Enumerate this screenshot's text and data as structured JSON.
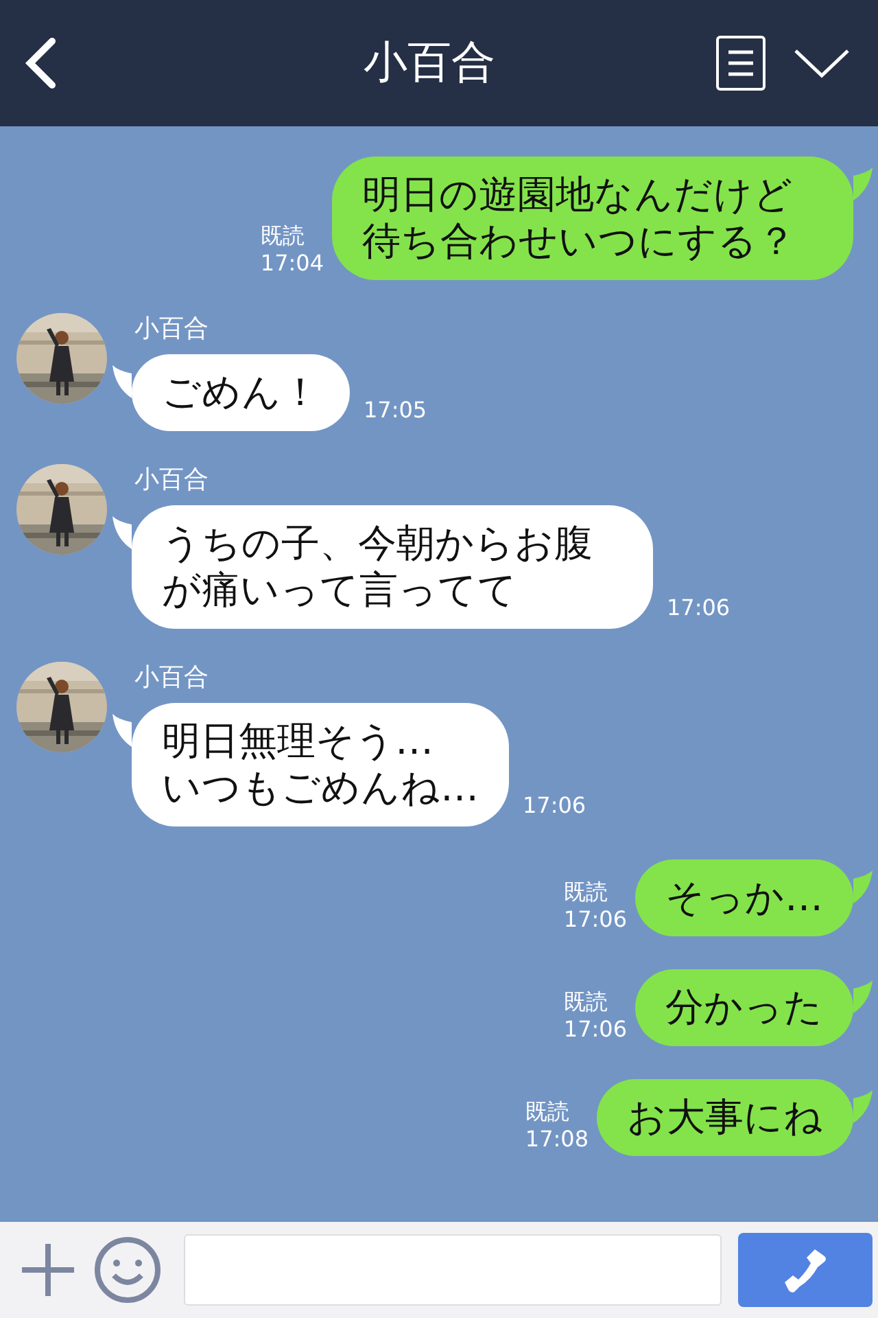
{
  "header": {
    "title": "小百合"
  },
  "messages": [
    {
      "kind": "sent",
      "text": "明日の遊園地なんだけど待ち合わせいつにする？",
      "read": "既読",
      "time": "17:04"
    },
    {
      "kind": "received",
      "name": "小百合",
      "text": "ごめん！",
      "time": "17:05"
    },
    {
      "kind": "received",
      "name": "小百合",
      "text": "うちの子、今朝からお腹が痛いって言ってて",
      "time": "17:06"
    },
    {
      "kind": "received",
      "name": "小百合",
      "text": "明日無理そう…\nいつもごめんね…",
      "time": "17:06"
    },
    {
      "kind": "sent",
      "text": "そっか…",
      "read": "既読",
      "time": "17:06"
    },
    {
      "kind": "sent",
      "text": "分かった",
      "read": "既読",
      "time": "17:06"
    },
    {
      "kind": "sent",
      "text": "お大事にね",
      "read": "既読",
      "time": "17:08"
    }
  ]
}
